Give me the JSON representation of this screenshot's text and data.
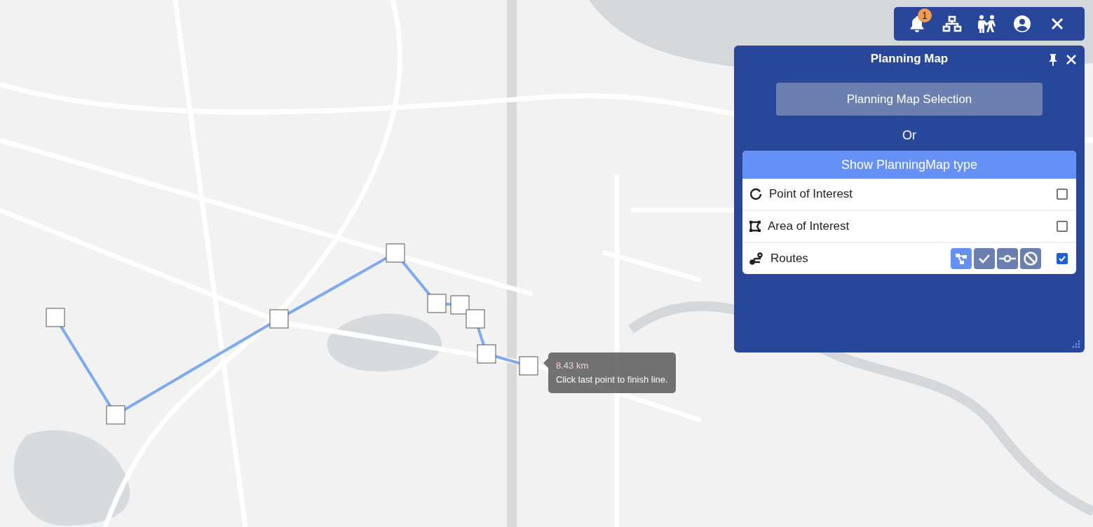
{
  "toolbar": {
    "notification_count": "1"
  },
  "panel": {
    "title": "Planning Map",
    "selection_button": "Planning Map Selection",
    "separator": "Or",
    "section_title": "Show PlanningMap type",
    "types": [
      {
        "kind": "point",
        "label": "Point of Interest",
        "checked": false
      },
      {
        "kind": "area",
        "label": "Area of Interest",
        "checked": false
      },
      {
        "kind": "routes",
        "label": "Routes",
        "checked": true,
        "tools": [
          {
            "kind": "draw",
            "selected": true
          },
          {
            "kind": "confirm",
            "selected": false
          },
          {
            "kind": "node",
            "selected": false
          },
          {
            "kind": "cancel",
            "selected": false
          }
        ]
      }
    ]
  },
  "measure_tooltip": {
    "distance": "8.43 km",
    "hint": "Click last point to finish line."
  }
}
